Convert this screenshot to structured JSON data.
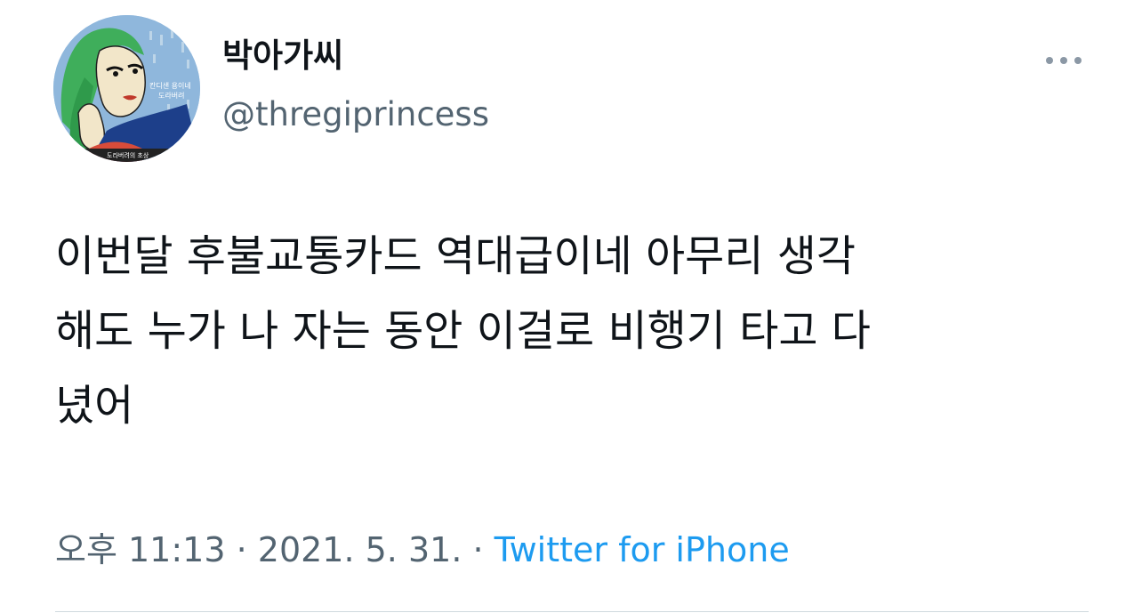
{
  "tweet": {
    "display_name": "박아가씨",
    "handle": "@thregiprincess",
    "avatar_text_top": "칸디샌 용이네",
    "avatar_text_mid": "도라버려",
    "avatar_text_bottom": "도라버려의 초상",
    "text": "이번달 후불교통카드 역대급이네 아무리 생각\n해도 누가 나 자는 동안 이걸로 비행기 타고 다\n녔어",
    "time": "오후 11:13",
    "separator": " · ",
    "date": "2021. 5. 31.",
    "source": "Twitter for iPhone",
    "more_icon": "more-horizontal-icon"
  },
  "colors": {
    "primary_text": "#0f1419",
    "secondary_text": "#536471",
    "link": "#1d9bf0",
    "divider": "#cfd9de"
  }
}
